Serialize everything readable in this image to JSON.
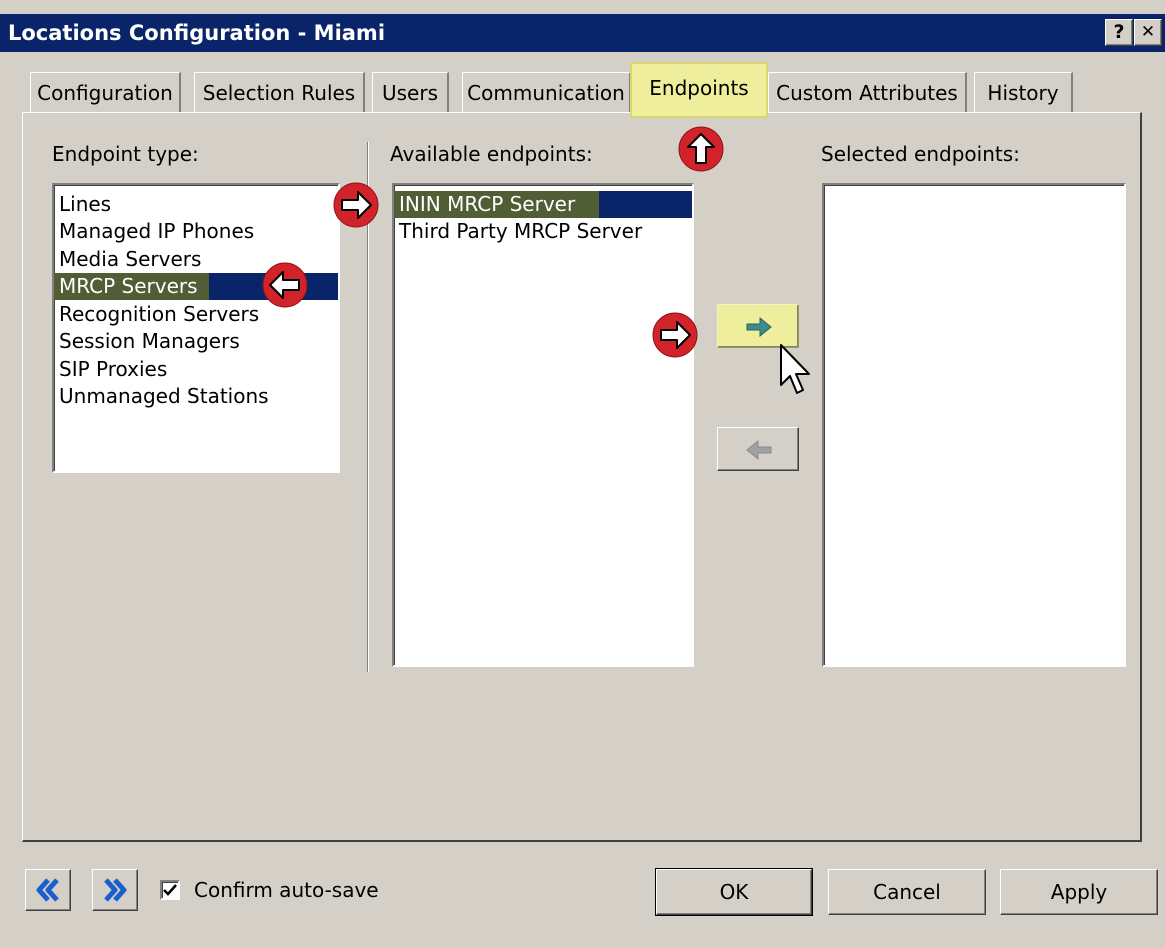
{
  "window": {
    "title": "Locations Configuration - Miami",
    "help_glyph": "?",
    "close_glyph": "✕"
  },
  "tabs": [
    {
      "label": "Configuration"
    },
    {
      "label": "Selection Rules"
    },
    {
      "label": "Users"
    },
    {
      "label": "Communication"
    },
    {
      "label": "Endpoints",
      "active": true
    },
    {
      "label": "Custom Attributes"
    },
    {
      "label": "History"
    }
  ],
  "endpoint_type": {
    "label": "Endpoint type:",
    "items": [
      "Lines",
      "Managed IP Phones",
      "Media Servers",
      "MRCP Servers",
      "Recognition Servers",
      "Session Managers",
      "SIP Proxies",
      "Unmanaged Stations"
    ],
    "selected": "MRCP Servers"
  },
  "available_endpoints": {
    "label": "Available endpoints:",
    "items": [
      "ININ MRCP Server",
      "Third Party MRCP Server"
    ],
    "selected": "ININ MRCP Server"
  },
  "selected_endpoints": {
    "label": "Selected endpoints:",
    "items": []
  },
  "footer": {
    "confirm_autosave_label": "Confirm auto-save",
    "confirm_autosave_checked": true,
    "ok_label": "OK",
    "cancel_label": "Cancel",
    "apply_label": "Apply"
  },
  "icons": {
    "add": "arrow-right-icon",
    "remove": "arrow-left-icon",
    "prev": "double-chevron-left-icon",
    "next": "double-chevron-right-icon"
  },
  "colors": {
    "titlebar": "#0a246a",
    "selection": "#0a246a",
    "highlight": "#eeee9c",
    "annotation": "#d2232a",
    "face": "#d4d0c8"
  }
}
